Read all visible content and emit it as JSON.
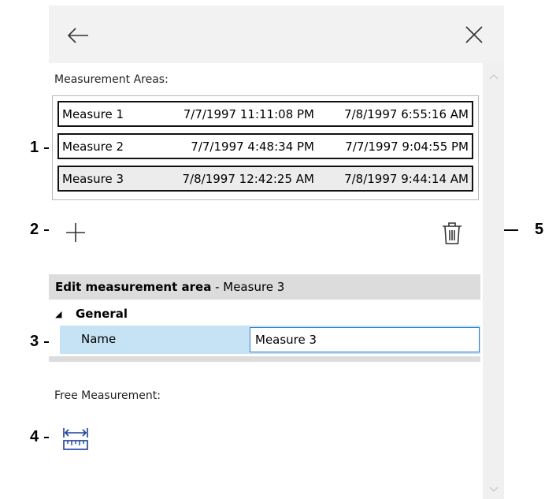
{
  "callouts": [
    "1",
    "2",
    "3",
    "4",
    "5"
  ],
  "header": {
    "back_icon": "arrow-left-icon",
    "close_icon": "close-icon"
  },
  "measurement_areas": {
    "label": "Measurement Areas:",
    "rows": [
      {
        "name": "Measure 1",
        "start": "7/7/1997 11:11:08 PM",
        "end": "7/8/1997 6:55:16 AM"
      },
      {
        "name": "Measure 2",
        "start": "7/7/1997 4:48:34 PM",
        "end": "7/7/1997 9:04:55 PM"
      },
      {
        "name": "Measure 3",
        "start": "7/8/1997 12:42:25 AM",
        "end": "7/8/1997 9:44:14 AM"
      }
    ],
    "selected_index": 2
  },
  "actions": {
    "add_icon": "plus-icon",
    "delete_icon": "trash-icon"
  },
  "edit": {
    "title": "Edit measurement area",
    "subtitle": " - Measure 3",
    "category": "General",
    "property_label": "Name",
    "property_value": "Measure 3"
  },
  "free_measurement": {
    "label": "Free Measurement:",
    "icon": "ruler-measure-icon"
  },
  "colors": {
    "header_bg": "#f2f2f2",
    "selected_row_bg": "#c6e3f5",
    "section_bg": "#dcdcdc",
    "input_border": "#2f7fd0"
  }
}
